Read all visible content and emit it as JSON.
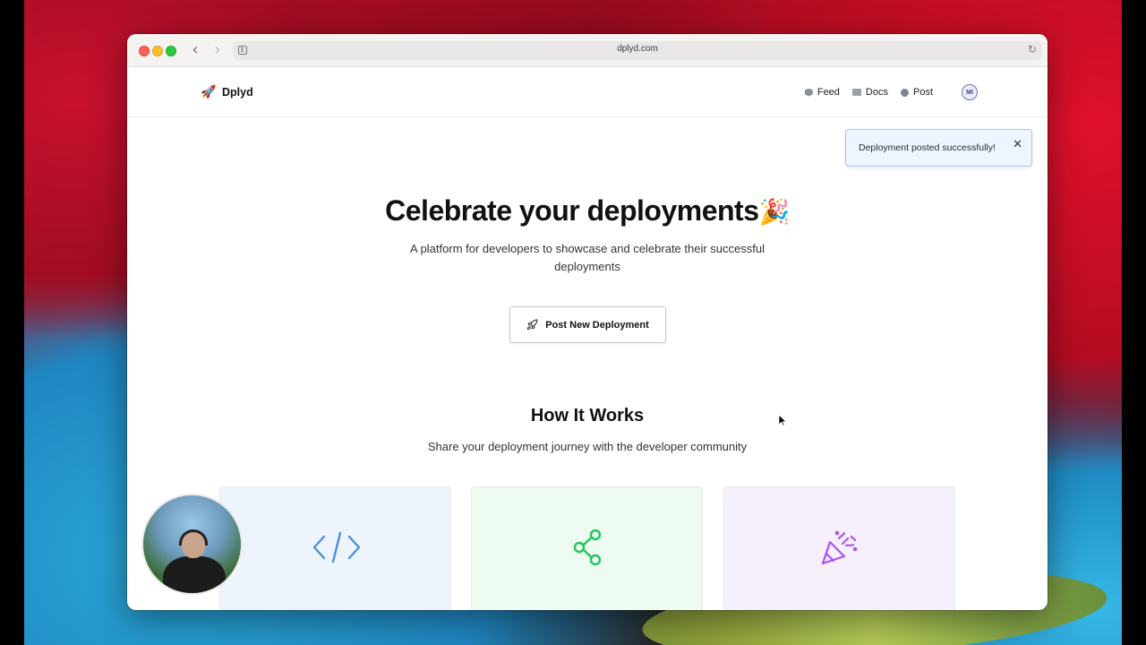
{
  "browser": {
    "url": "dplyd.com"
  },
  "header": {
    "brand_name": "Dplyd",
    "brand_logo": "🚀",
    "nav": [
      {
        "label": "Feed",
        "icon": "cube-icon"
      },
      {
        "label": "Docs",
        "icon": "book-icon"
      },
      {
        "label": "Post",
        "icon": "speech-bubble-icon"
      }
    ],
    "avatar_initials": "MI"
  },
  "toast": {
    "message": "Deployment posted successfully!",
    "close_glyph": "✕"
  },
  "hero": {
    "title": "Celebrate your deployments",
    "title_emoji": "🎉",
    "subtitle": "A platform for developers to showcase and celebrate their successful deployments",
    "cta_label": "Post New Deployment",
    "cta_icon": "rocket-icon"
  },
  "how_it_works": {
    "title": "How It Works",
    "subtitle": "Share your deployment journey with the developer community",
    "cards": [
      {
        "icon": "code-icon",
        "color": "#4a90d9"
      },
      {
        "icon": "share-icon",
        "color": "#22c55e"
      },
      {
        "icon": "party-popper-icon",
        "color": "#a855f7"
      }
    ]
  }
}
